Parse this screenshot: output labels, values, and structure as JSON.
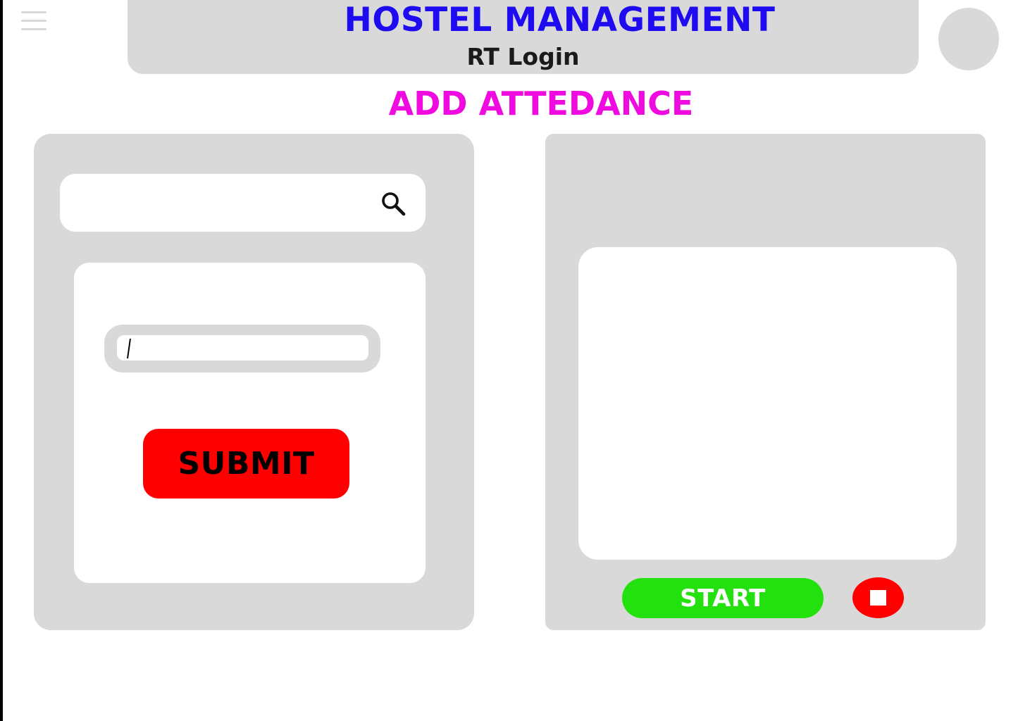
{
  "header": {
    "app_title": "HOSTEL MANAGEMENT",
    "subtitle": "RT Login"
  },
  "page": {
    "heading": "ADD ATTEDANCE"
  },
  "search": {
    "icon": "search-icon",
    "value": ""
  },
  "form": {
    "input_value": "",
    "submit_label": "SUBMIT"
  },
  "controls": {
    "start_label": "START",
    "stop_icon": "stop-icon"
  },
  "colors": {
    "title": "#1f0bf0",
    "heading": "#ef0ae0",
    "panel_gray": "#d9d9d9",
    "submit_red": "#ff0000",
    "start_green": "#22e10e",
    "stop_red": "#ff0000"
  }
}
